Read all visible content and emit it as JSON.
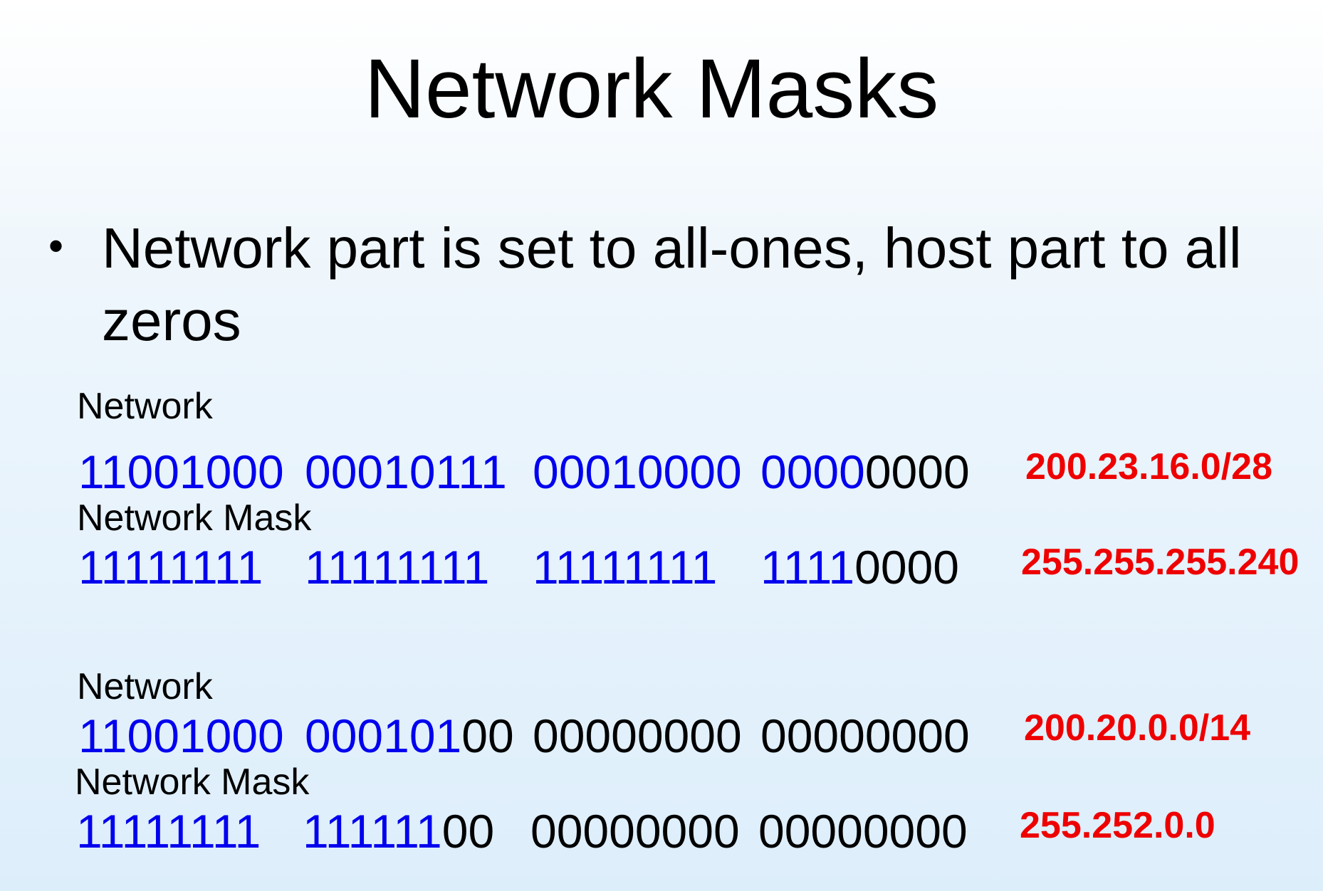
{
  "title": "Network Masks",
  "bullet": "Network part is set to all-ones, host part to all zeros",
  "colors": {
    "network_bits": "#0000ee",
    "host_bits": "#000000",
    "dotted_notation": "#ee0000"
  },
  "examples": [
    {
      "network": {
        "label": "Network",
        "octets": [
          {
            "net": "11001000",
            "host": ""
          },
          {
            "net": "00010111",
            "host": ""
          },
          {
            "net": "00010000",
            "host": ""
          },
          {
            "net": "0000",
            "host": "0000"
          }
        ],
        "dotted": "200.23.16.0/28"
      },
      "mask": {
        "label": "Network Mask",
        "octets": [
          {
            "net": "11111111",
            "host": ""
          },
          {
            "net": "11111111",
            "host": ""
          },
          {
            "net": "11111111",
            "host": ""
          },
          {
            "net": "1111",
            "host": "0000"
          }
        ],
        "dotted": "255.255.255.240"
      }
    },
    {
      "network": {
        "label": "Network",
        "octets": [
          {
            "net": "11001000",
            "host": ""
          },
          {
            "net": "000101",
            "host": "00"
          },
          {
            "net": "",
            "host": "00000000"
          },
          {
            "net": "",
            "host": "00000000"
          }
        ],
        "dotted": "200.20.0.0/14"
      },
      "mask": {
        "label": "Network Mask",
        "octets": [
          {
            "net": "11111111",
            "host": ""
          },
          {
            "net": "111111",
            "host": "00"
          },
          {
            "net": "",
            "host": "00000000"
          },
          {
            "net": "",
            "host": "00000000"
          }
        ],
        "dotted": "255.252.0.0"
      }
    }
  ]
}
